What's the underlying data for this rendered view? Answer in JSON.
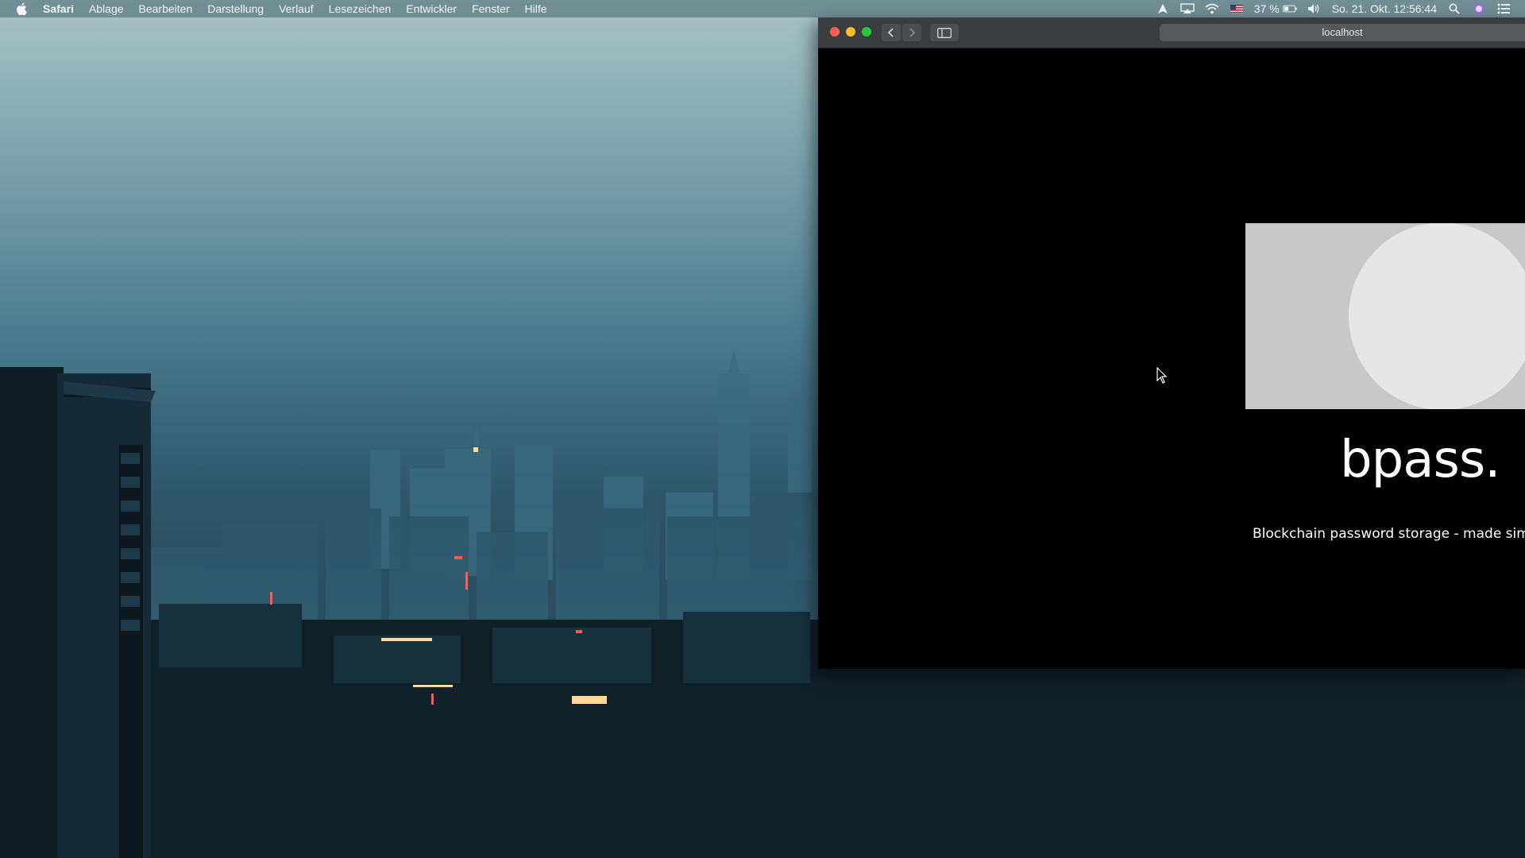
{
  "menubar": {
    "app_name": "Safari",
    "items": [
      "Ablage",
      "Bearbeiten",
      "Darstellung",
      "Verlauf",
      "Lesezeichen",
      "Entwickler",
      "Fenster",
      "Hilfe"
    ],
    "battery_percent": "37 %",
    "datetime": "So. 21. Okt. 12:56:44",
    "status_icons": [
      "location-arrow-icon",
      "airplay-icon",
      "wifi-icon",
      "us-flag-icon",
      "battery-icon",
      "volume-icon",
      "spotlight-search-icon",
      "siri-icon",
      "notification-center-icon"
    ]
  },
  "browser": {
    "address": "localhost",
    "icons": [
      "close-icon",
      "minimize-icon",
      "maximize-icon",
      "chevron-left-icon",
      "chevron-right-icon",
      "sidebar-icon"
    ]
  },
  "page": {
    "brand": "bpass.",
    "tagline": "Blockchain password storage - made simple"
  },
  "colors": {
    "page_background": "#000000",
    "logo_box": "#c8c8c8",
    "logo_circle": "#e6e6e6",
    "text": "#ffffff"
  }
}
